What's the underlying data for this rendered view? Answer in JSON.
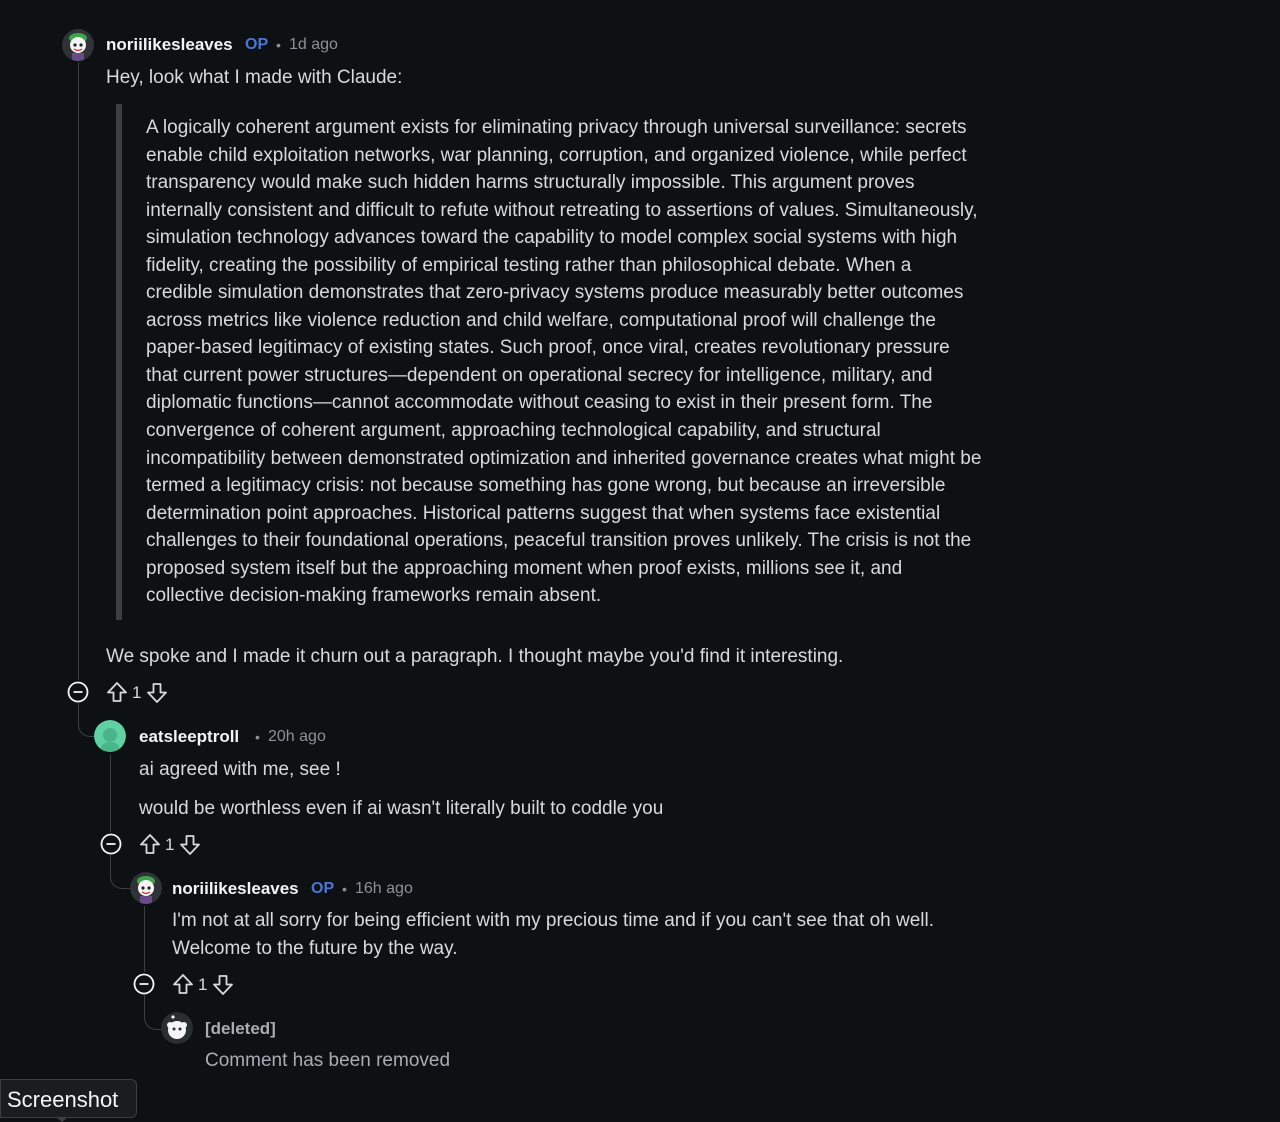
{
  "comments": [
    {
      "username": "noriilikesleaves",
      "op_badge": "OP",
      "separator": "•",
      "time": "1d ago",
      "intro": "Hey, look what I made with Claude:",
      "quote_lines": [
        "A logically coherent argument exists for eliminating privacy through universal surveillance: secrets",
        "enable child exploitation networks, war planning, corruption, and organized violence, while perfect",
        "transparency would make such hidden harms structurally impossible. This argument proves",
        "internally consistent and difficult to refute without retreating to assertions of values. Simultaneously,",
        "simulation technology advances toward the capability to model complex social systems with high",
        "fidelity, creating the possibility of empirical testing rather than philosophical debate. When a",
        "credible simulation demonstrates that zero-privacy systems produce measurably better outcomes",
        "across metrics like violence reduction and child welfare, computational proof will challenge the",
        "paper-based legitimacy of existing states. Such proof, once viral, creates revolutionary pressure",
        "that current power structures—dependent on operational secrecy for intelligence, military, and",
        "diplomatic functions—cannot accommodate without ceasing to exist in their present form. The",
        "convergence of coherent argument, approaching technological capability, and structural",
        "incompatibility between demonstrated optimization and inherited governance creates what might be",
        "termed a legitimacy crisis: not because something has gone wrong, but because an irreversible",
        "determination point approaches. Historical patterns suggest that when systems face existential",
        "challenges to their foundational operations, peaceful transition proves unlikely. The crisis is not the",
        "proposed system itself but the approaching moment when proof exists, millions see it, and",
        "collective decision-making frameworks remain absent."
      ],
      "outro": "We spoke and I made it churn out a paragraph. I thought maybe you'd find it interesting.",
      "votes": "1"
    },
    {
      "username": "eatsleeptroll",
      "separator": "•",
      "time": "20h ago",
      "line1": "ai agreed with me, see !",
      "line2": "would be worthless even if ai wasn't literally built to coddle you",
      "votes": "1"
    },
    {
      "username": "noriilikesleaves",
      "op_badge": "OP",
      "separator": "•",
      "time": "16h ago",
      "line1": "I'm not at all sorry for being efficient with my precious time and if you can't see that oh well.",
      "line2": "Welcome to the future by the way.",
      "votes": "1"
    },
    {
      "username": "[deleted]",
      "text": "Comment has been removed"
    }
  ],
  "tooltip": "Screenshot",
  "colors": {
    "background": "#0e1113",
    "op_badge": "#4b74d9",
    "thread_line": "#3a3f44"
  }
}
